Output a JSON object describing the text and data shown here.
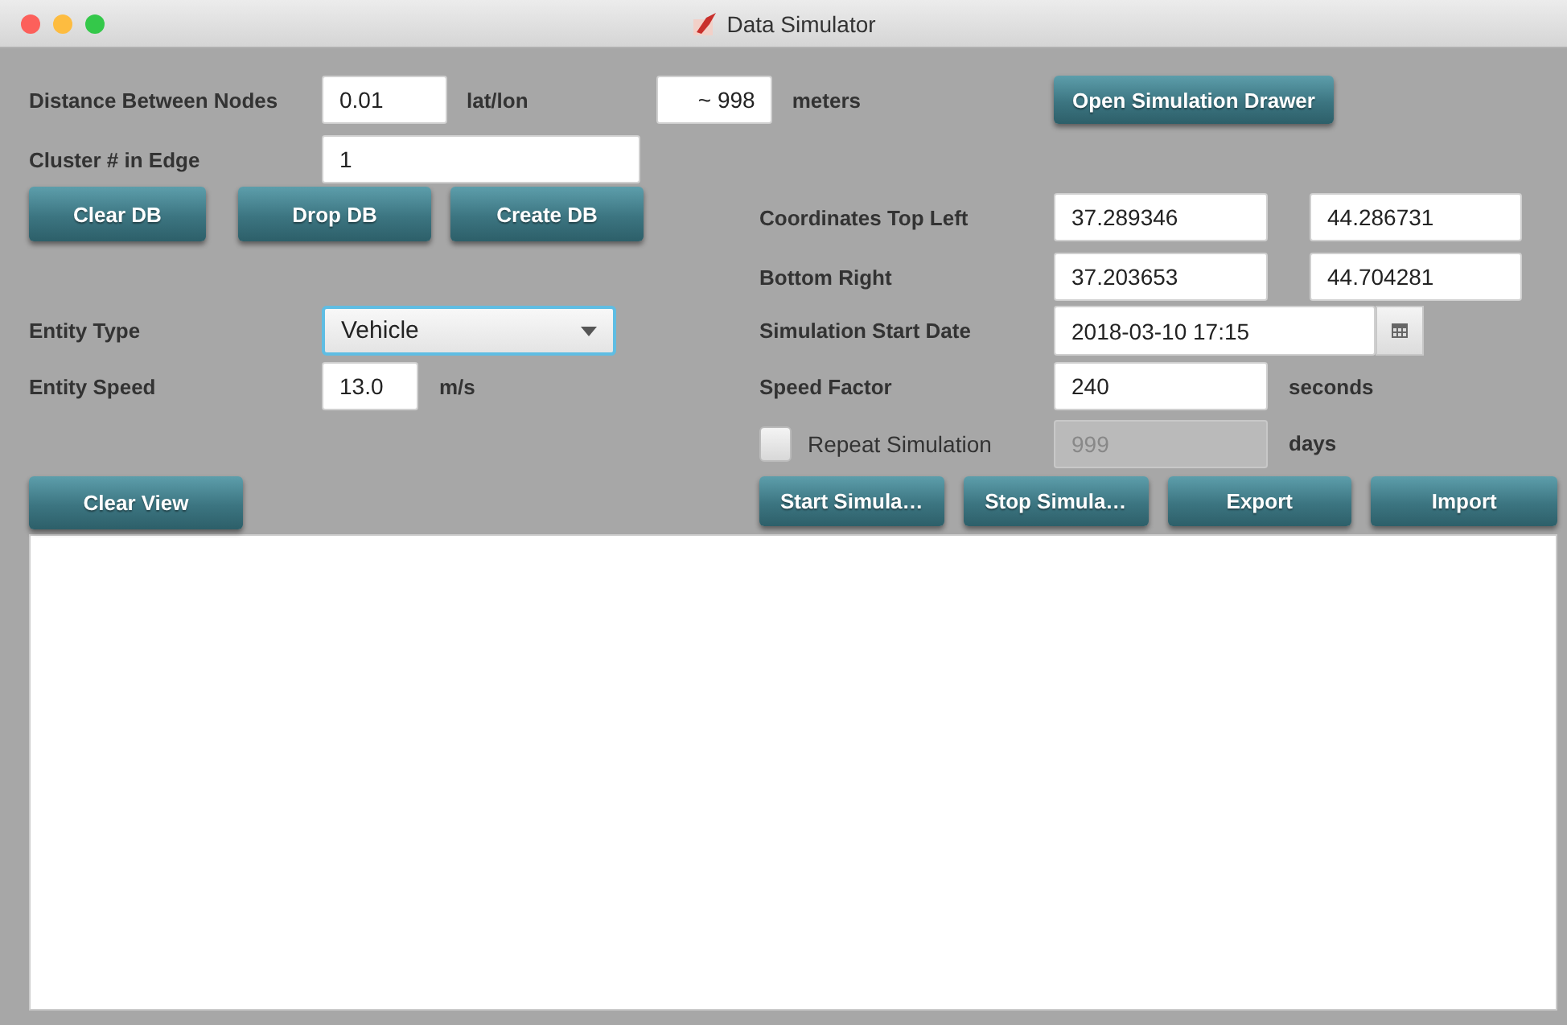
{
  "window": {
    "title": "Data Simulator"
  },
  "distance": {
    "label": "Distance Between Nodes",
    "value": "0.01",
    "unit": "lat/lon",
    "meters_value": "~ 998",
    "meters_unit": "meters"
  },
  "cluster": {
    "label": "Cluster # in Edge",
    "value": "1"
  },
  "db_buttons": [
    "Clear DB",
    "Drop DB",
    "Create DB"
  ],
  "open_drawer_button": "Open Simulation Drawer",
  "top_left": {
    "label": "Coordinates Top Left",
    "lat": "37.289346",
    "lon": "44.286731"
  },
  "bottom_right": {
    "label": "Bottom Right",
    "lat": "37.203653",
    "lon": "44.704281"
  },
  "entity_type": {
    "label": "Entity Type",
    "value": "Vehicle"
  },
  "entity_speed": {
    "label": "Entity Speed",
    "value": "13.0",
    "unit": "m/s"
  },
  "start_date": {
    "label": "Simulation Start Date",
    "value": "2018-03-10 17:15"
  },
  "speed_factor": {
    "label": "Speed Factor",
    "value": "240",
    "unit": "seconds"
  },
  "repeat": {
    "label": "Repeat Simulation",
    "checked": false,
    "days_value": "999",
    "days_disabled": true,
    "unit": "days"
  },
  "clear_view_button": "Clear View",
  "sim_buttons": [
    "Start Simula…",
    "Stop Simula…",
    "Export",
    "Import"
  ]
}
